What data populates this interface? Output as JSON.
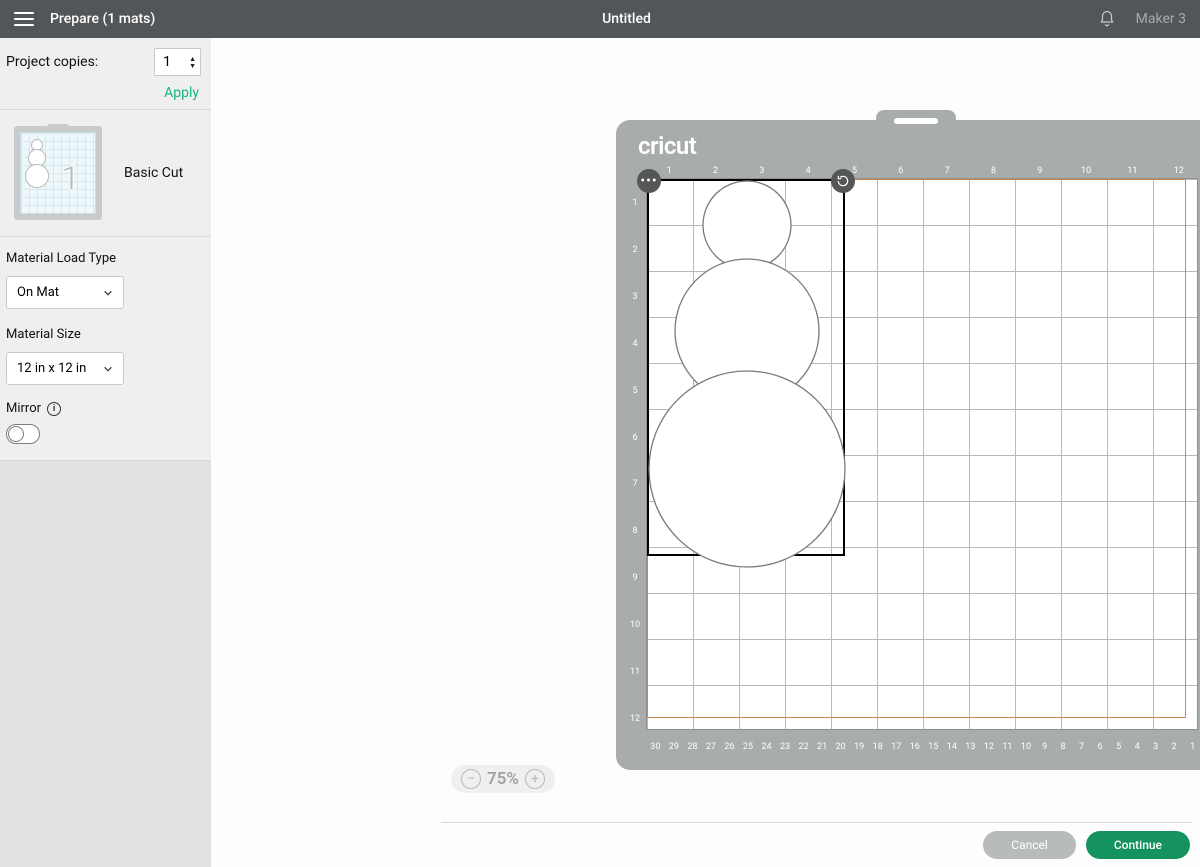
{
  "header": {
    "page_title_left": "Prepare (1 mats)",
    "project_title": "Untitled",
    "machine": "Maker 3"
  },
  "sidebar": {
    "copies_label": "Project copies:",
    "copies_value": "1",
    "apply_label": "Apply",
    "mat_item_label": "Basic Cut",
    "mat_item_number": "1",
    "material_load_type_label": "Material Load Type",
    "material_load_type_value": "On Mat",
    "material_size_label": "Material Size",
    "material_size_value": "12 in x 12 in",
    "mirror_label": "Mirror",
    "mirror_on": false
  },
  "canvas": {
    "brand": "cricut",
    "grid_units": 12,
    "selection": {
      "x_in": 0.0,
      "y_in": 0.0,
      "w_in": 4.3,
      "h_in": 8.2
    },
    "zoom_display": "75%"
  },
  "footer": {
    "cancel_label": "Cancel",
    "continue_label": "Continue"
  }
}
